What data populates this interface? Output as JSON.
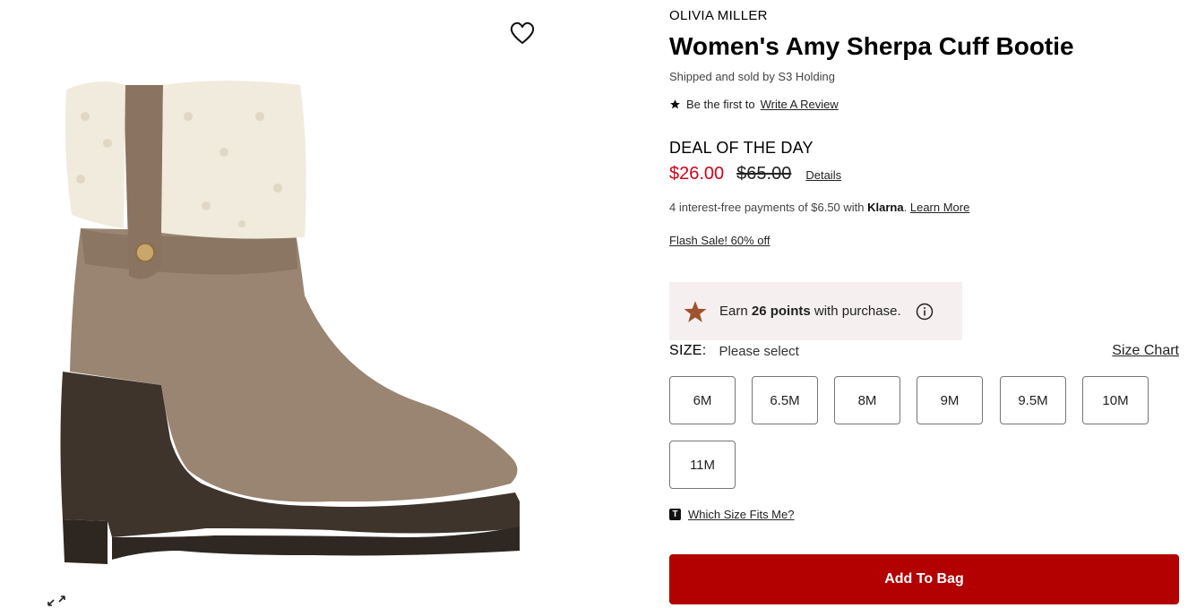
{
  "product": {
    "brand": "OLIVIA MILLER",
    "title": "Women's Amy Sherpa Cuff Bootie",
    "seller": "Shipped and sold by S3 Holding",
    "review_prefix": "Be the first to",
    "review_link": "Write A Review",
    "deal_label": "DEAL OF THE DAY",
    "sale_price": "$26.00",
    "original_price": "$65.00",
    "details_link": "Details",
    "klarna_text": "4 interest-free payments of $6.50 with",
    "klarna_brand": "Klarna",
    "klarna_sep": ".",
    "klarna_learn_more": "Learn More",
    "flash_sale": "Flash Sale! 60% off"
  },
  "points": {
    "prefix": "Earn",
    "amount": "26 points",
    "suffix": "with purchase."
  },
  "size": {
    "label": "SIZE:",
    "selected": "Please select",
    "chart_link": "Size Chart",
    "options": [
      "6M",
      "6.5M",
      "8M",
      "9M",
      "9.5M",
      "10M",
      "11M"
    ],
    "fits_badge": "T",
    "fits_link": "Which Size Fits Me?"
  },
  "actions": {
    "add_to_bag": "Add To Bag"
  },
  "colors": {
    "sale_red": "#d0021b",
    "bag_button": "#b30000",
    "points_bg": "#f5f0ef",
    "points_star": "#a0522d"
  },
  "icons": [
    "heart-icon",
    "star-icon",
    "info-icon",
    "expand-icon",
    "points-star-icon"
  ]
}
